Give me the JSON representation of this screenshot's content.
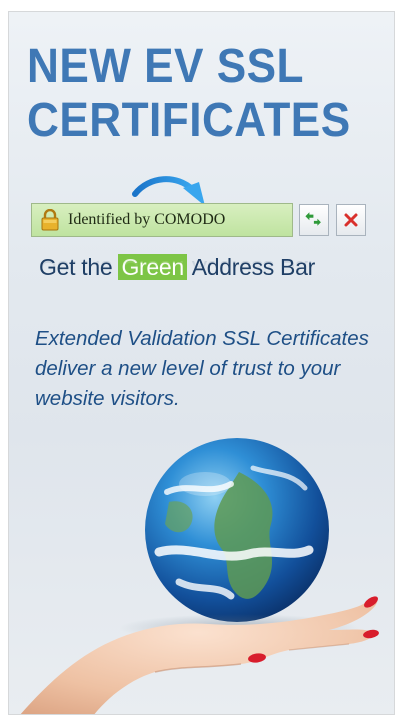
{
  "ad": {
    "headline_line1": "NEW EV SSL",
    "headline_line2": "CERTIFICATES",
    "address_bar": {
      "identity_text": "Identified by COMODO",
      "lock_icon": "padlock-icon",
      "refresh_icon": "refresh-arrows-icon",
      "stop_icon": "stop-x-icon"
    },
    "tagline": {
      "before": "Get the ",
      "highlight": "Green",
      "after": " Address Bar"
    },
    "body": "Extended Validation SSL Certificates deliver a new level of trust to your website visitors.",
    "colors": {
      "headline": "#3f78b5",
      "green_bar": "#bfe3a0",
      "green_highlight": "#7dc546",
      "body_text": "#1e4f86"
    }
  }
}
